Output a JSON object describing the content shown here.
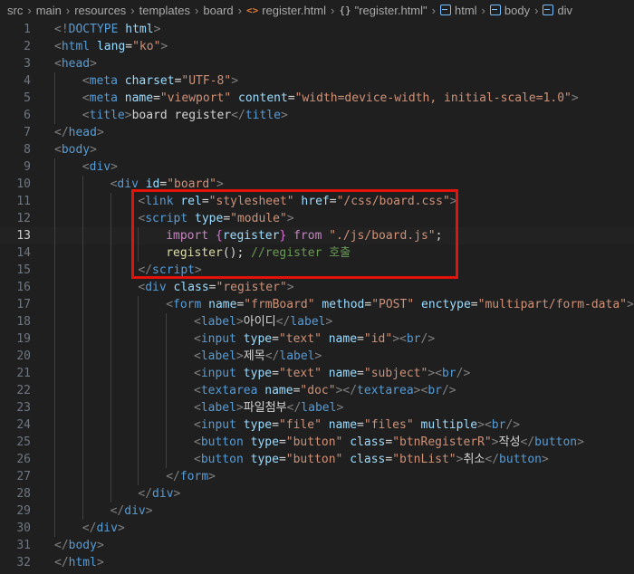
{
  "breadcrumb": [
    {
      "label": "src",
      "icon": ""
    },
    {
      "label": "main",
      "icon": ""
    },
    {
      "label": "resources",
      "icon": ""
    },
    {
      "label": "templates",
      "icon": ""
    },
    {
      "label": "board",
      "icon": ""
    },
    {
      "label": "register.html",
      "icon": "html-file-icon"
    },
    {
      "label": "\"register.html\"",
      "icon": "object-icon"
    },
    {
      "label": "html",
      "icon": "element-icon"
    },
    {
      "label": "body",
      "icon": "element-icon"
    },
    {
      "label": "div",
      "icon": "element-icon"
    }
  ],
  "editor": {
    "active_line": 13,
    "highlight_color": "#e3120b",
    "lines": [
      {
        "n": "1",
        "indent": 0,
        "tokens": [
          [
            "br",
            "<!"
          ],
          [
            "tag",
            "DOCTYPE"
          ],
          [
            "txt",
            " "
          ],
          [
            "att",
            "html"
          ],
          [
            "br",
            ">"
          ]
        ]
      },
      {
        "n": "2",
        "indent": 0,
        "tokens": [
          [
            "br",
            "<"
          ],
          [
            "tag",
            "html"
          ],
          [
            "txt",
            " "
          ],
          [
            "att",
            "lang"
          ],
          [
            "txt",
            "="
          ],
          [
            "str",
            "\"ko\""
          ],
          [
            "br",
            ">"
          ]
        ]
      },
      {
        "n": "3",
        "indent": 0,
        "tokens": [
          [
            "br",
            "<"
          ],
          [
            "tag",
            "head"
          ],
          [
            "br",
            ">"
          ]
        ]
      },
      {
        "n": "4",
        "indent": 1,
        "tokens": [
          [
            "br",
            "<"
          ],
          [
            "tag",
            "meta"
          ],
          [
            "txt",
            " "
          ],
          [
            "att",
            "charset"
          ],
          [
            "txt",
            "="
          ],
          [
            "str",
            "\"UTF-8\""
          ],
          [
            "br",
            ">"
          ]
        ]
      },
      {
        "n": "5",
        "indent": 1,
        "tokens": [
          [
            "br",
            "<"
          ],
          [
            "tag",
            "meta"
          ],
          [
            "txt",
            " "
          ],
          [
            "att",
            "name"
          ],
          [
            "txt",
            "="
          ],
          [
            "str",
            "\"viewport\""
          ],
          [
            "txt",
            " "
          ],
          [
            "att",
            "content"
          ],
          [
            "txt",
            "="
          ],
          [
            "str",
            "\"width=device-width, initial-scale=1.0\""
          ],
          [
            "br",
            ">"
          ]
        ]
      },
      {
        "n": "6",
        "indent": 1,
        "tokens": [
          [
            "br",
            "<"
          ],
          [
            "tag",
            "title"
          ],
          [
            "br",
            ">"
          ],
          [
            "txt",
            "board register"
          ],
          [
            "br",
            "</"
          ],
          [
            "tag",
            "title"
          ],
          [
            "br",
            ">"
          ]
        ]
      },
      {
        "n": "7",
        "indent": 0,
        "tokens": [
          [
            "br",
            "</"
          ],
          [
            "tag",
            "head"
          ],
          [
            "br",
            ">"
          ]
        ]
      },
      {
        "n": "8",
        "indent": 0,
        "tokens": [
          [
            "br",
            "<"
          ],
          [
            "tag",
            "body"
          ],
          [
            "br",
            ">"
          ]
        ]
      },
      {
        "n": "9",
        "indent": 1,
        "tokens": [
          [
            "br",
            "<"
          ],
          [
            "tag",
            "div"
          ],
          [
            "br",
            ">"
          ]
        ]
      },
      {
        "n": "10",
        "indent": 2,
        "tokens": [
          [
            "br",
            "<"
          ],
          [
            "tag",
            "div"
          ],
          [
            "txt",
            " "
          ],
          [
            "att",
            "id"
          ],
          [
            "txt",
            "="
          ],
          [
            "str",
            "\"board\""
          ],
          [
            "br",
            ">"
          ]
        ]
      },
      {
        "n": "11",
        "indent": 3,
        "tokens": [
          [
            "br",
            "<"
          ],
          [
            "tag",
            "link"
          ],
          [
            "txt",
            " "
          ],
          [
            "att",
            "rel"
          ],
          [
            "txt",
            "="
          ],
          [
            "str",
            "\"stylesheet\""
          ],
          [
            "txt",
            " "
          ],
          [
            "att",
            "href"
          ],
          [
            "txt",
            "="
          ],
          [
            "str",
            "\"/css/board.css\""
          ],
          [
            "br",
            ">"
          ]
        ]
      },
      {
        "n": "12",
        "indent": 3,
        "tokens": [
          [
            "br",
            "<"
          ],
          [
            "tag",
            "script"
          ],
          [
            "txt",
            " "
          ],
          [
            "att",
            "type"
          ],
          [
            "txt",
            "="
          ],
          [
            "str",
            "\"module\""
          ],
          [
            "br",
            ">"
          ]
        ]
      },
      {
        "n": "13",
        "indent": 4,
        "tokens": [
          [
            "kw",
            "import"
          ],
          [
            "txt",
            " "
          ],
          [
            "brc",
            "{"
          ],
          [
            "var",
            "register"
          ],
          [
            "brc",
            "}"
          ],
          [
            "txt",
            " "
          ],
          [
            "kw",
            "from"
          ],
          [
            "txt",
            " "
          ],
          [
            "str",
            "\"./js/board.js\""
          ],
          [
            "pun",
            ";"
          ]
        ]
      },
      {
        "n": "14",
        "indent": 4,
        "tokens": [
          [
            "fn",
            "register"
          ],
          [
            "pun",
            "(); "
          ],
          [
            "com",
            "//register 호출"
          ]
        ]
      },
      {
        "n": "15",
        "indent": 3,
        "tokens": [
          [
            "br",
            "</"
          ],
          [
            "tag",
            "script"
          ],
          [
            "br",
            ">"
          ]
        ]
      },
      {
        "n": "16",
        "indent": 3,
        "tokens": [
          [
            "br",
            "<"
          ],
          [
            "tag",
            "div"
          ],
          [
            "txt",
            " "
          ],
          [
            "att",
            "class"
          ],
          [
            "txt",
            "="
          ],
          [
            "str",
            "\"register\""
          ],
          [
            "br",
            ">"
          ]
        ]
      },
      {
        "n": "17",
        "indent": 4,
        "tokens": [
          [
            "br",
            "<"
          ],
          [
            "tag",
            "form"
          ],
          [
            "txt",
            " "
          ],
          [
            "att",
            "name"
          ],
          [
            "txt",
            "="
          ],
          [
            "str",
            "\"frmBoard\""
          ],
          [
            "txt",
            " "
          ],
          [
            "att",
            "method"
          ],
          [
            "txt",
            "="
          ],
          [
            "str",
            "\"POST\""
          ],
          [
            "txt",
            " "
          ],
          [
            "att",
            "enctype"
          ],
          [
            "txt",
            "="
          ],
          [
            "str",
            "\"multipart/form-data\""
          ],
          [
            "br",
            ">"
          ]
        ]
      },
      {
        "n": "18",
        "indent": 5,
        "tokens": [
          [
            "br",
            "<"
          ],
          [
            "tag",
            "label"
          ],
          [
            "br",
            ">"
          ],
          [
            "txt",
            "아이디"
          ],
          [
            "br",
            "</"
          ],
          [
            "tag",
            "label"
          ],
          [
            "br",
            ">"
          ]
        ]
      },
      {
        "n": "19",
        "indent": 5,
        "tokens": [
          [
            "br",
            "<"
          ],
          [
            "tag",
            "input"
          ],
          [
            "txt",
            " "
          ],
          [
            "att",
            "type"
          ],
          [
            "txt",
            "="
          ],
          [
            "str",
            "\"text\""
          ],
          [
            "txt",
            " "
          ],
          [
            "att",
            "name"
          ],
          [
            "txt",
            "="
          ],
          [
            "str",
            "\"id\""
          ],
          [
            "br",
            ">"
          ],
          [
            "br",
            "<"
          ],
          [
            "tag",
            "br"
          ],
          [
            "br",
            "/>"
          ]
        ]
      },
      {
        "n": "20",
        "indent": 5,
        "tokens": [
          [
            "br",
            "<"
          ],
          [
            "tag",
            "label"
          ],
          [
            "br",
            ">"
          ],
          [
            "txt",
            "제목"
          ],
          [
            "br",
            "</"
          ],
          [
            "tag",
            "label"
          ],
          [
            "br",
            ">"
          ]
        ]
      },
      {
        "n": "21",
        "indent": 5,
        "tokens": [
          [
            "br",
            "<"
          ],
          [
            "tag",
            "input"
          ],
          [
            "txt",
            " "
          ],
          [
            "att",
            "type"
          ],
          [
            "txt",
            "="
          ],
          [
            "str",
            "\"text\""
          ],
          [
            "txt",
            " "
          ],
          [
            "att",
            "name"
          ],
          [
            "txt",
            "="
          ],
          [
            "str",
            "\"subject\""
          ],
          [
            "br",
            ">"
          ],
          [
            "br",
            "<"
          ],
          [
            "tag",
            "br"
          ],
          [
            "br",
            "/>"
          ]
        ]
      },
      {
        "n": "22",
        "indent": 5,
        "tokens": [
          [
            "br",
            "<"
          ],
          [
            "tag",
            "textarea"
          ],
          [
            "txt",
            " "
          ],
          [
            "att",
            "name"
          ],
          [
            "txt",
            "="
          ],
          [
            "str",
            "\"doc\""
          ],
          [
            "br",
            "></"
          ],
          [
            "tag",
            "textarea"
          ],
          [
            "br",
            ">"
          ],
          [
            "br",
            "<"
          ],
          [
            "tag",
            "br"
          ],
          [
            "br",
            "/>"
          ]
        ]
      },
      {
        "n": "23",
        "indent": 5,
        "tokens": [
          [
            "br",
            "<"
          ],
          [
            "tag",
            "label"
          ],
          [
            "br",
            ">"
          ],
          [
            "txt",
            "파일첨부"
          ],
          [
            "br",
            "</"
          ],
          [
            "tag",
            "label"
          ],
          [
            "br",
            ">"
          ]
        ]
      },
      {
        "n": "24",
        "indent": 5,
        "tokens": [
          [
            "br",
            "<"
          ],
          [
            "tag",
            "input"
          ],
          [
            "txt",
            " "
          ],
          [
            "att",
            "type"
          ],
          [
            "txt",
            "="
          ],
          [
            "str",
            "\"file\""
          ],
          [
            "txt",
            " "
          ],
          [
            "att",
            "name"
          ],
          [
            "txt",
            "="
          ],
          [
            "str",
            "\"files\""
          ],
          [
            "txt",
            " "
          ],
          [
            "att",
            "multiple"
          ],
          [
            "br",
            ">"
          ],
          [
            "br",
            "<"
          ],
          [
            "tag",
            "br"
          ],
          [
            "br",
            "/>"
          ]
        ]
      },
      {
        "n": "25",
        "indent": 5,
        "tokens": [
          [
            "br",
            "<"
          ],
          [
            "tag",
            "button"
          ],
          [
            "txt",
            " "
          ],
          [
            "att",
            "type"
          ],
          [
            "txt",
            "="
          ],
          [
            "str",
            "\"button\""
          ],
          [
            "txt",
            " "
          ],
          [
            "att",
            "class"
          ],
          [
            "txt",
            "="
          ],
          [
            "str",
            "\"btnRegisterR\""
          ],
          [
            "br",
            ">"
          ],
          [
            "txt",
            "작성"
          ],
          [
            "br",
            "</"
          ],
          [
            "tag",
            "button"
          ],
          [
            "br",
            ">"
          ]
        ]
      },
      {
        "n": "26",
        "indent": 5,
        "tokens": [
          [
            "br",
            "<"
          ],
          [
            "tag",
            "button"
          ],
          [
            "txt",
            " "
          ],
          [
            "att",
            "type"
          ],
          [
            "txt",
            "="
          ],
          [
            "str",
            "\"button\""
          ],
          [
            "txt",
            " "
          ],
          [
            "att",
            "class"
          ],
          [
            "txt",
            "="
          ],
          [
            "str",
            "\"btnList\""
          ],
          [
            "br",
            ">"
          ],
          [
            "txt",
            "취소"
          ],
          [
            "br",
            "</"
          ],
          [
            "tag",
            "button"
          ],
          [
            "br",
            ">"
          ]
        ]
      },
      {
        "n": "27",
        "indent": 4,
        "tokens": [
          [
            "br",
            "</"
          ],
          [
            "tag",
            "form"
          ],
          [
            "br",
            ">"
          ]
        ]
      },
      {
        "n": "28",
        "indent": 3,
        "tokens": [
          [
            "br",
            "</"
          ],
          [
            "tag",
            "div"
          ],
          [
            "br",
            ">"
          ]
        ]
      },
      {
        "n": "29",
        "indent": 2,
        "tokens": [
          [
            "br",
            "</"
          ],
          [
            "tag",
            "div"
          ],
          [
            "br",
            ">"
          ]
        ]
      },
      {
        "n": "30",
        "indent": 1,
        "tokens": [
          [
            "br",
            "</"
          ],
          [
            "tag",
            "div"
          ],
          [
            "br",
            ">"
          ]
        ]
      },
      {
        "n": "31",
        "indent": 0,
        "tokens": [
          [
            "br",
            "</"
          ],
          [
            "tag",
            "body"
          ],
          [
            "br",
            ">"
          ]
        ]
      },
      {
        "n": "32",
        "indent": 0,
        "tokens": [
          [
            "br",
            "</"
          ],
          [
            "tag",
            "html"
          ],
          [
            "br",
            ">"
          ]
        ]
      }
    ]
  }
}
